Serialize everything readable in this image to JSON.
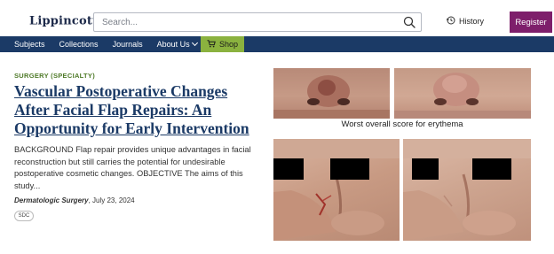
{
  "header": {
    "logo": "Lippincott",
    "logo_mark": "®",
    "search": {
      "placeholder": "Search..."
    },
    "history_label": "History",
    "register_label": "Register"
  },
  "nav": {
    "items": [
      {
        "label": "Subjects"
      },
      {
        "label": "Collections"
      },
      {
        "label": "Journals"
      },
      {
        "label": "About Us"
      }
    ],
    "shop_label": "Shop"
  },
  "article": {
    "category": "SURGERY (SPECIALTY)",
    "title": "Vascular Postoperative Changes After Facial Flap Repairs: An Opportunity for Early Intervention",
    "abstract": "BACKGROUND Flap repair provides unique advantages in facial reconstruction but still carries the potential for undesirable postoperative cosmetic changes. OBJECTIVE The aims of this study...",
    "journal": "Dermatologic Surgery",
    "date": ", July 23, 2024",
    "tag": "SDC"
  },
  "figure": {
    "caption": "Worst overall score for erythema"
  },
  "colors": {
    "navy": "#1b3a66",
    "register": "#7e1f6b",
    "shop": "#8bb23f",
    "category": "#4e7a28"
  },
  "icons": [
    "search-icon",
    "history-icon",
    "cart-icon",
    "chevron-down-icon"
  ]
}
